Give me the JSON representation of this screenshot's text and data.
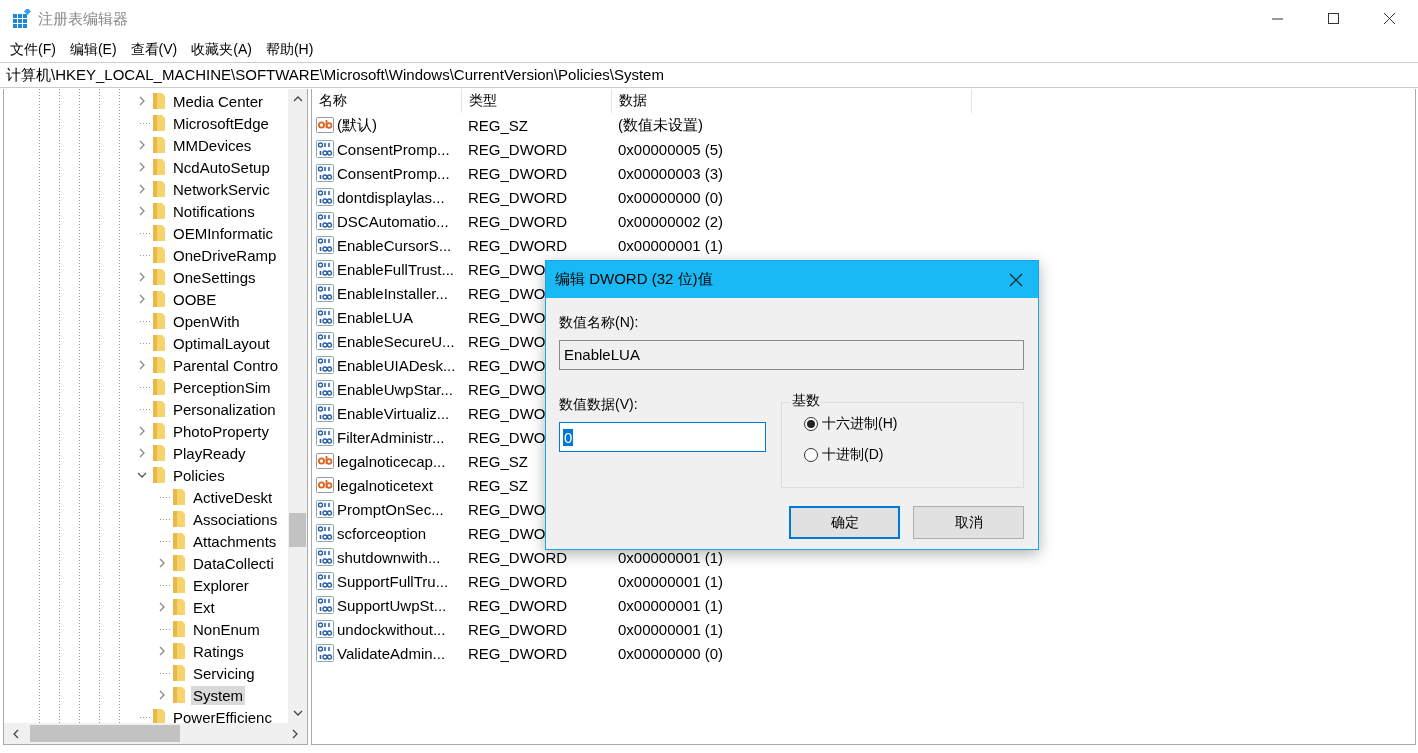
{
  "window": {
    "title": "注册表编辑器"
  },
  "menu": [
    "文件(F)",
    "编辑(E)",
    "查看(V)",
    "收藏夹(A)",
    "帮助(H)"
  ],
  "address": "计算机\\HKEY_LOCAL_MACHINE\\SOFTWARE\\Microsoft\\Windows\\CurrentVersion\\Policies\\System",
  "tree": [
    {
      "label": "Media Center",
      "kind": "node",
      "expanded": false,
      "selected": false
    },
    {
      "label": "MicrosoftEdge",
      "kind": "leaf",
      "selected": false
    },
    {
      "label": "MMDevices",
      "kind": "node",
      "expanded": false,
      "selected": false
    },
    {
      "label": "NcdAutoSetup",
      "kind": "node",
      "expanded": false,
      "selected": false
    },
    {
      "label": "NetworkServic",
      "kind": "node",
      "expanded": false,
      "selected": false
    },
    {
      "label": "Notifications",
      "kind": "node",
      "expanded": false,
      "selected": false
    },
    {
      "label": "OEMInformatic",
      "kind": "leaf",
      "selected": false
    },
    {
      "label": "OneDriveRamp",
      "kind": "leaf",
      "selected": false
    },
    {
      "label": "OneSettings",
      "kind": "node",
      "expanded": false,
      "selected": false
    },
    {
      "label": "OOBE",
      "kind": "node",
      "expanded": false,
      "selected": false
    },
    {
      "label": "OpenWith",
      "kind": "leaf",
      "selected": false
    },
    {
      "label": "OptimalLayout",
      "kind": "leaf",
      "selected": false
    },
    {
      "label": "Parental Contro",
      "kind": "node",
      "expanded": false,
      "selected": false
    },
    {
      "label": "PerceptionSim",
      "kind": "leaf",
      "selected": false
    },
    {
      "label": "Personalization",
      "kind": "leaf",
      "selected": false
    },
    {
      "label": "PhotoProperty",
      "kind": "node",
      "expanded": false,
      "selected": false
    },
    {
      "label": "PlayReady",
      "kind": "node",
      "expanded": false,
      "selected": false
    },
    {
      "label": "Policies",
      "kind": "node",
      "expanded": true,
      "selected": false,
      "children": [
        {
          "label": "ActiveDeskt",
          "kind": "leaf",
          "selected": false
        },
        {
          "label": "Associations",
          "kind": "leaf",
          "selected": false
        },
        {
          "label": "Attachments",
          "kind": "leaf",
          "selected": false
        },
        {
          "label": "DataCollecti",
          "kind": "node",
          "expanded": false,
          "selected": false
        },
        {
          "label": "Explorer",
          "kind": "leaf",
          "selected": false
        },
        {
          "label": "Ext",
          "kind": "node",
          "expanded": false,
          "selected": false
        },
        {
          "label": "NonEnum",
          "kind": "leaf",
          "selected": false
        },
        {
          "label": "Ratings",
          "kind": "node",
          "expanded": false,
          "selected": false
        },
        {
          "label": "Servicing",
          "kind": "leaf",
          "selected": false
        },
        {
          "label": "System",
          "kind": "node",
          "expanded": false,
          "selected": true
        }
      ]
    },
    {
      "label": "PowerEfficienc",
      "kind": "leaf",
      "selected": false
    }
  ],
  "table": {
    "columns": [
      "名称",
      "类型",
      "数据"
    ],
    "rows": [
      {
        "kind": "sz",
        "name": "(默认)",
        "type": "REG_SZ",
        "data": "(数值未设置)"
      },
      {
        "kind": "dword",
        "name": "ConsentPromp...",
        "type": "REG_DWORD",
        "data": "0x00000005 (5)"
      },
      {
        "kind": "dword",
        "name": "ConsentPromp...",
        "type": "REG_DWORD",
        "data": "0x00000003 (3)"
      },
      {
        "kind": "dword",
        "name": "dontdisplaylas...",
        "type": "REG_DWORD",
        "data": "0x00000000 (0)"
      },
      {
        "kind": "dword",
        "name": "DSCAutomatio...",
        "type": "REG_DWORD",
        "data": "0x00000002 (2)"
      },
      {
        "kind": "dword",
        "name": "EnableCursorS...",
        "type": "REG_DWORD",
        "data": "0x00000001 (1)"
      },
      {
        "kind": "dword",
        "name": "EnableFullTrust...",
        "type": "REG_DWO"
      },
      {
        "kind": "dword",
        "name": "EnableInstaller...",
        "type": "REG_DWO"
      },
      {
        "kind": "dword",
        "name": "EnableLUA",
        "type": "REG_DWO"
      },
      {
        "kind": "dword",
        "name": "EnableSecureU...",
        "type": "REG_DWO"
      },
      {
        "kind": "dword",
        "name": "EnableUIADesk...",
        "type": "REG_DWO"
      },
      {
        "kind": "dword",
        "name": "EnableUwpStar...",
        "type": "REG_DWO"
      },
      {
        "kind": "dword",
        "name": "EnableVirtualiz...",
        "type": "REG_DWO"
      },
      {
        "kind": "dword",
        "name": "FilterAdministr...",
        "type": "REG_DWO"
      },
      {
        "kind": "sz",
        "name": "legalnoticecap...",
        "type": "REG_SZ"
      },
      {
        "kind": "sz",
        "name": "legalnoticetext",
        "type": "REG_SZ"
      },
      {
        "kind": "dword",
        "name": "PromptOnSec...",
        "type": "REG_DWO"
      },
      {
        "kind": "dword",
        "name": "scforceoption",
        "type": "REG_DWO"
      },
      {
        "kind": "dword",
        "name": "shutdownwith...",
        "type": "REG_DWORD",
        "data": "0x00000001 (1)"
      },
      {
        "kind": "dword",
        "name": "SupportFullTru...",
        "type": "REG_DWORD",
        "data": "0x00000001 (1)"
      },
      {
        "kind": "dword",
        "name": "SupportUwpSt...",
        "type": "REG_DWORD",
        "data": "0x00000001 (1)"
      },
      {
        "kind": "dword",
        "name": "undockwithout...",
        "type": "REG_DWORD",
        "data": "0x00000001 (1)"
      },
      {
        "kind": "dword",
        "name": "ValidateAdmin...",
        "type": "REG_DWORD",
        "data": "0x00000000 (0)"
      }
    ]
  },
  "dialog": {
    "title": "编辑 DWORD (32 位)值",
    "name_label": "数值名称(N):",
    "name_value": "EnableLUA",
    "data_label": "数值数据(V):",
    "data_value": "0",
    "base_label": "基数",
    "radios": [
      {
        "label": "十六进制(H)",
        "selected": true
      },
      {
        "label": "十进制(D)",
        "selected": false
      }
    ],
    "buttons": [
      {
        "label": "确定",
        "default": true
      },
      {
        "label": "取消",
        "default": false
      }
    ]
  }
}
